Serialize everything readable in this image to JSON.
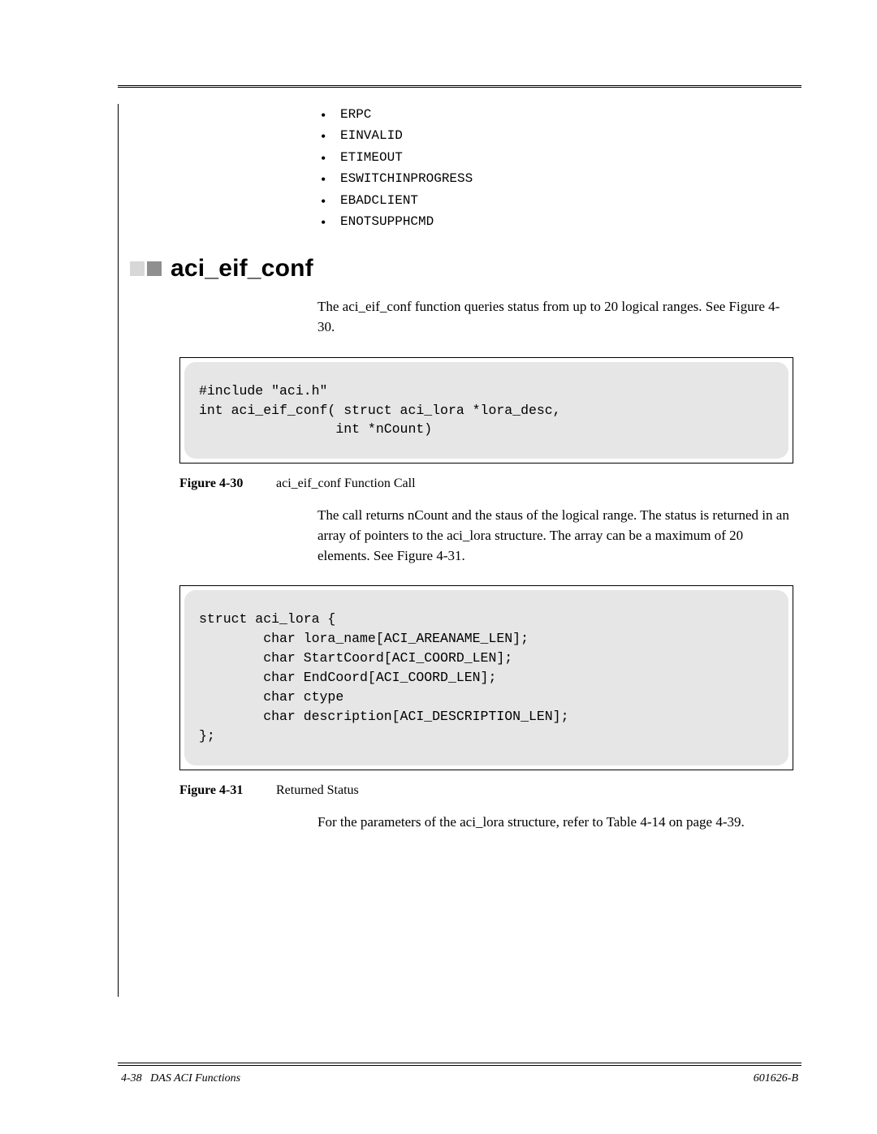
{
  "errors": {
    "items": [
      "ERPC",
      "EINVALID",
      "ETIMEOUT",
      "ESWITCHINPROGRESS",
      "EBADCLIENT",
      "ENOTSUPPHCMD"
    ]
  },
  "section": {
    "title": "aci_eif_conf"
  },
  "paragraphs": {
    "intro": "The aci_eif_conf function queries status from up to 20 logical ranges. See Figure 4-30.",
    "afterCode1": "The call returns nCount and the staus of the logical range. The status is returned in an array of pointers to the aci_lora structure. The array can be a maximum of 20 elements. See Figure 4-31.",
    "afterCode2": "For the parameters of the aci_lora structure, refer to Table 4-14 on page 4-39."
  },
  "code1": "#include \"aci.h\"\nint aci_eif_conf( struct aci_lora *lora_desc,\n                 int *nCount)",
  "code2": "struct aci_lora {\n        char lora_name[ACI_AREANAME_LEN];\n        char StartCoord[ACI_COORD_LEN];\n        char EndCoord[ACI_COORD_LEN];\n        char ctype\n        char description[ACI_DESCRIPTION_LEN];\n};",
  "figures": {
    "f30": {
      "label": "Figure 4-30",
      "text": "aci_eif_conf Function Call"
    },
    "f31": {
      "label": "Figure 4-31",
      "text": "Returned Status"
    }
  },
  "footer": {
    "pageNum": "4-38",
    "chapter": "DAS ACI Functions",
    "docId": "601626-B"
  }
}
